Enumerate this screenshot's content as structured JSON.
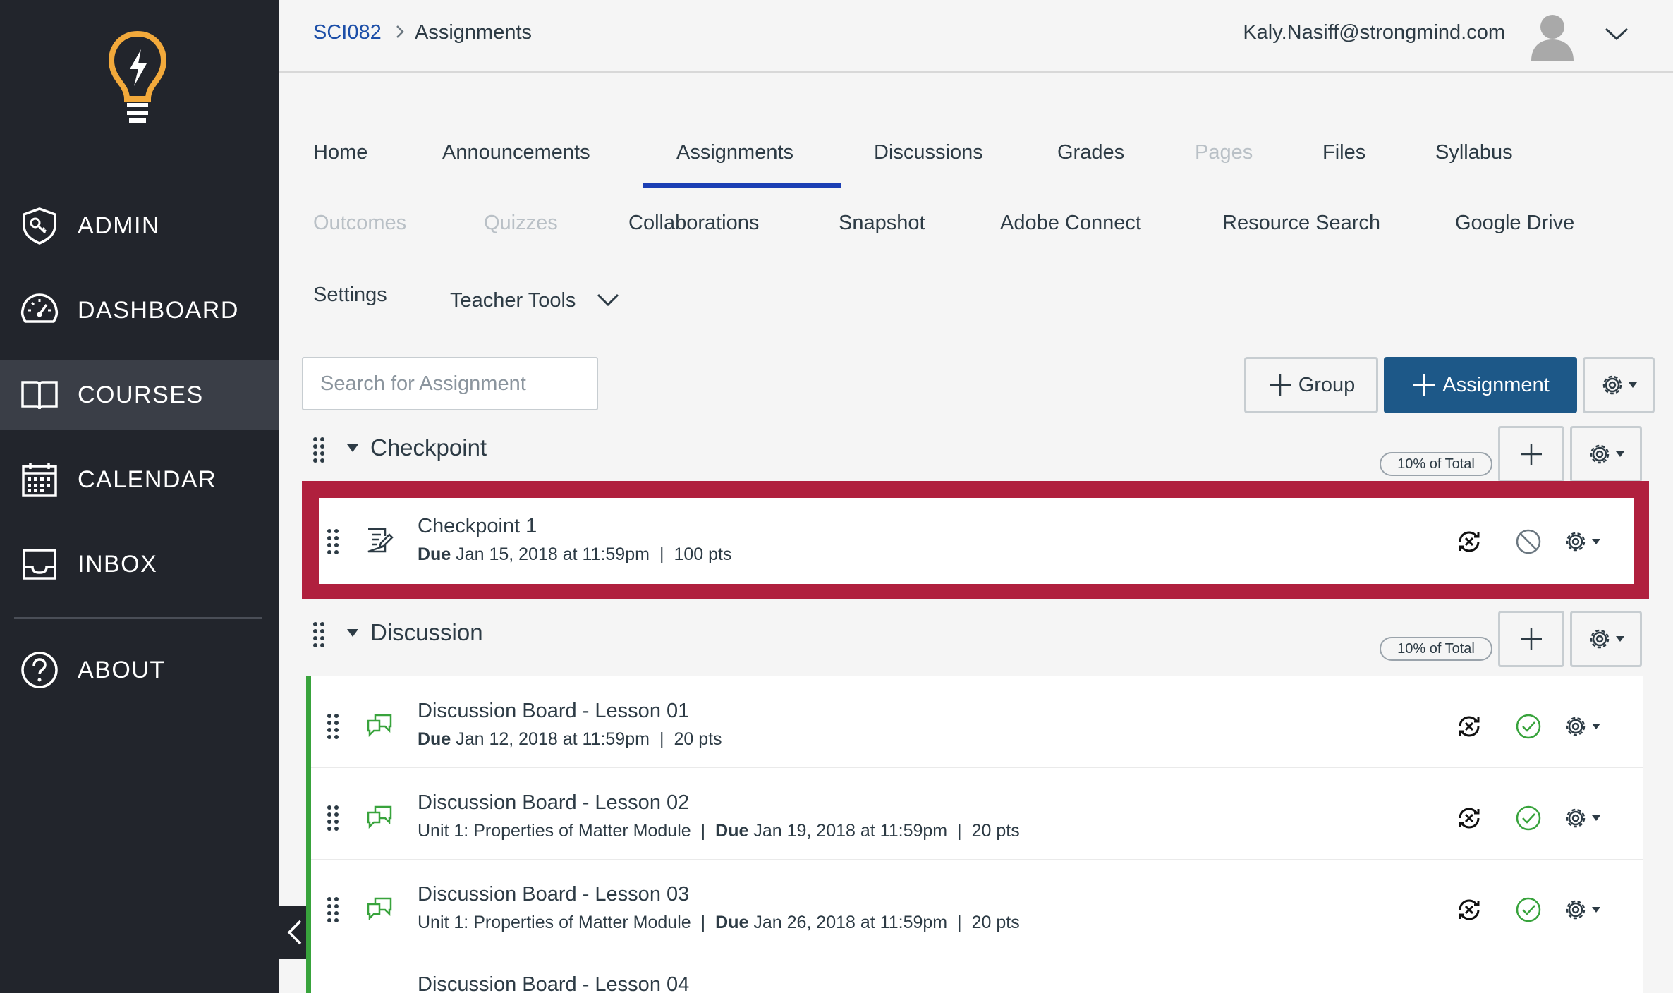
{
  "sidebar": {
    "items": [
      {
        "label": "ADMIN",
        "icon": "shield-key-icon"
      },
      {
        "label": "DASHBOARD",
        "icon": "speedometer-icon"
      },
      {
        "label": "COURSES",
        "icon": "book-icon",
        "active": true
      },
      {
        "label": "CALENDAR",
        "icon": "calendar-icon"
      },
      {
        "label": "INBOX",
        "icon": "inbox-icon"
      },
      {
        "label": "ABOUT",
        "icon": "question-icon"
      }
    ]
  },
  "header": {
    "breadcrumb": {
      "course": "SCI082",
      "current": "Assignments"
    },
    "user_email": "Kaly.Nasiff@strongmind.com"
  },
  "tabs": {
    "home": "Home",
    "announcements": "Announcements",
    "assignments": "Assignments",
    "discussions": "Discussions",
    "grades": "Grades",
    "pages": "Pages",
    "files": "Files",
    "syllabus": "Syllabus",
    "outcomes": "Outcomes",
    "quizzes": "Quizzes",
    "collaborations": "Collaborations",
    "snapshot": "Snapshot",
    "adobe_connect": "Adobe Connect",
    "resource_search": "Resource Search",
    "google_drive": "Google Drive",
    "settings": "Settings",
    "teacher_tools": "Teacher Tools"
  },
  "toolbar": {
    "search_placeholder": "Search for Assignment",
    "group_label": "Group",
    "assignment_label": "Assignment"
  },
  "groups": [
    {
      "title": "Checkpoint",
      "weight": "10% of Total",
      "items": [
        {
          "title": "Checkpoint 1",
          "due_label": "Due",
          "due": "Jan 15, 2018 at 11:59pm",
          "points": "100 pts"
        }
      ]
    },
    {
      "title": "Discussion",
      "weight": "10% of Total",
      "items": [
        {
          "title": "Discussion Board - Lesson 01",
          "due_label": "Due",
          "due": "Jan 12, 2018 at 11:59pm",
          "points": "20 pts"
        },
        {
          "title": "Discussion Board - Lesson 02",
          "module": "Unit 1: Properties of Matter Module",
          "due_label": "Due",
          "due": "Jan 19, 2018 at 11:59pm",
          "points": "20 pts"
        },
        {
          "title": "Discussion Board - Lesson 03",
          "module": "Unit 1: Properties of Matter Module",
          "due_label": "Due",
          "due": "Jan 26, 2018 at 11:59pm",
          "points": "20 pts"
        },
        {
          "title": "Discussion Board - Lesson 04"
        }
      ]
    }
  ],
  "colors": {
    "sidebar_bg": "#22252c",
    "accent_blue": "#1d5888",
    "highlight": "#b0203e",
    "published_green": "#38a33c",
    "link": "#1d4fa8"
  }
}
